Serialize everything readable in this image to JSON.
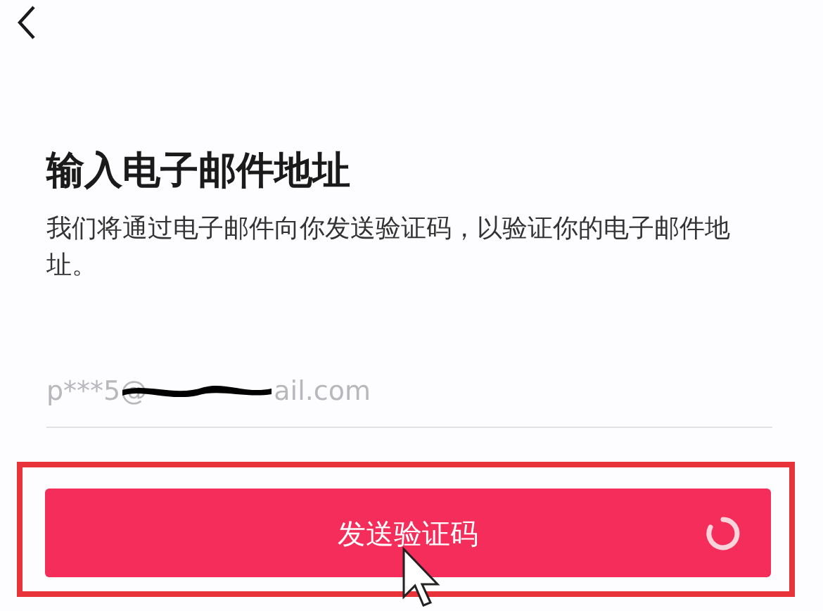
{
  "title": "输入电子邮件地址",
  "description": "我们将通过电子邮件向你发送验证码，以验证你的电子邮件地址。",
  "email_field": {
    "value_start": "p***5@",
    "value_end": "ail.com",
    "redacted": true
  },
  "send_button": {
    "label": "发送验证码",
    "loading": true,
    "highlighted": true
  }
}
